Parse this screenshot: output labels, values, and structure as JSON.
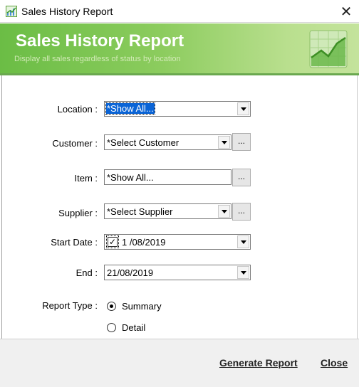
{
  "window": {
    "title": "Sales History Report",
    "close_glyph": "✕",
    "app_icon": "chart-icon"
  },
  "banner": {
    "title": "Sales History Report",
    "subtitle": "Display all sales regardless of status by location",
    "icon": "growth-chart-icon",
    "colors": {
      "gradient_start": "#6bbd45",
      "gradient_end": "#c4e39c"
    }
  },
  "form": {
    "location": {
      "label": "Location :",
      "value": "*Show All..."
    },
    "customer": {
      "label": "Customer :",
      "value": "*Select Customer",
      "browse": "..."
    },
    "item": {
      "label": "Item :",
      "value": "*Show All...",
      "browse": "..."
    },
    "supplier": {
      "label": "Supplier :",
      "value": "*Select Supplier",
      "browse": "..."
    },
    "start_date": {
      "label": "Start Date :",
      "value": "1 /08/2019",
      "checked": true,
      "check_glyph": "✓"
    },
    "end_date": {
      "label": "End :",
      "value": "21/08/2019"
    },
    "report_type": {
      "label": "Report Type :",
      "options": [
        {
          "label": "Summary",
          "selected": true
        },
        {
          "label": "Detail",
          "selected": false
        }
      ]
    }
  },
  "footer": {
    "generate_label": "Generate Report",
    "close_label": "Close"
  }
}
